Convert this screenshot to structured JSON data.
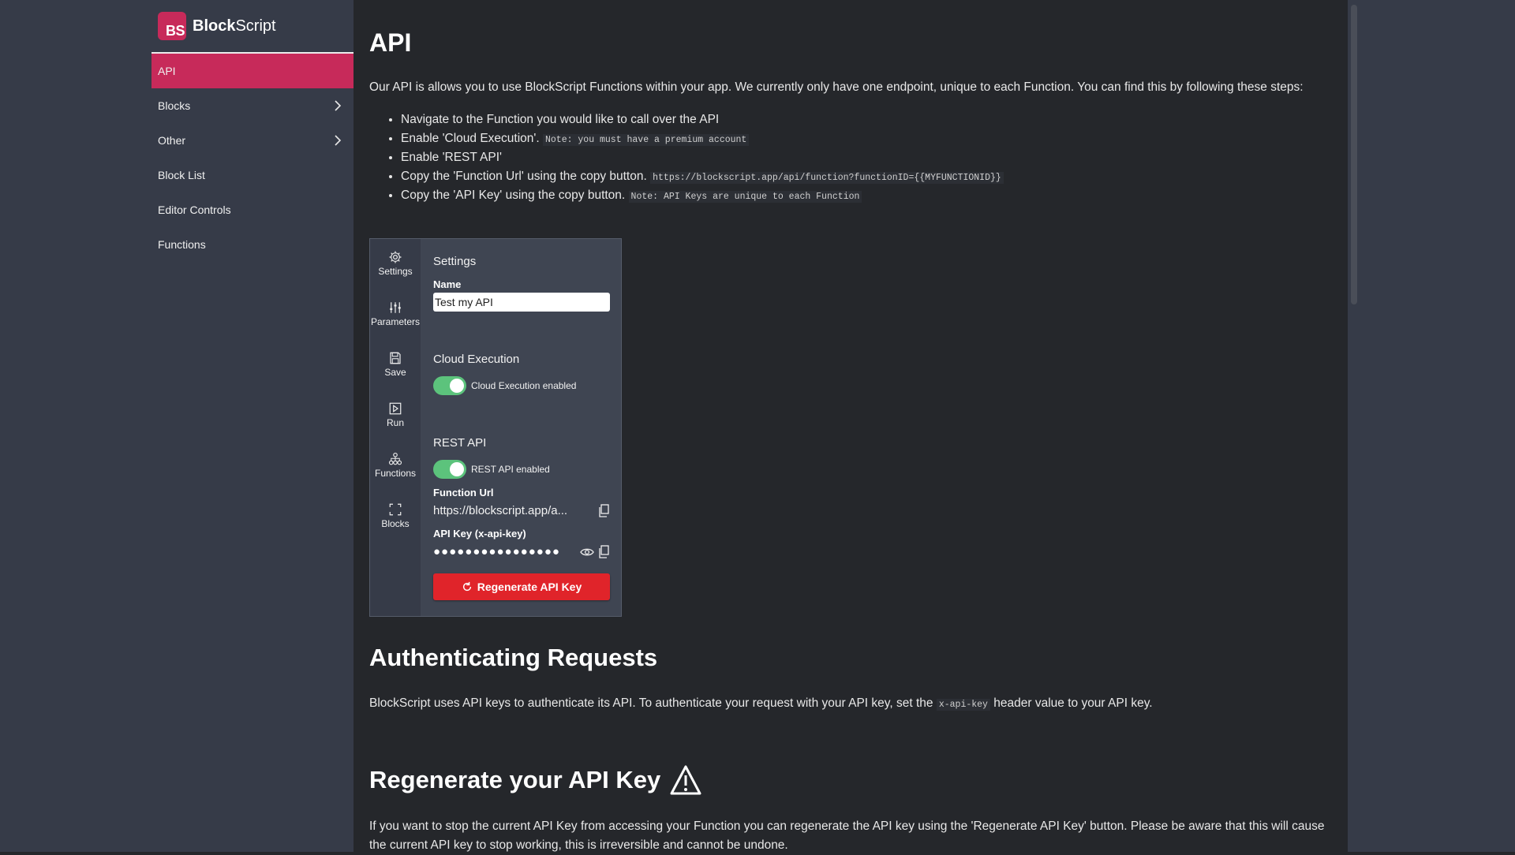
{
  "brand": {
    "logo_text": "BS",
    "name_bold": "Block",
    "name_rest": "Script"
  },
  "nav": [
    {
      "label": "API",
      "active": true,
      "has_chevron": false
    },
    {
      "label": "Blocks",
      "active": false,
      "has_chevron": true
    },
    {
      "label": "Other",
      "active": false,
      "has_chevron": true
    },
    {
      "label": "Block List",
      "active": false,
      "has_chevron": false
    },
    {
      "label": "Editor Controls",
      "active": false,
      "has_chevron": false
    },
    {
      "label": "Functions",
      "active": false,
      "has_chevron": false
    }
  ],
  "page": {
    "title": "API",
    "intro": "Our API is allows you to use BlockScript Functions within your app. We currently only have one endpoint, unique to each Function. You can find this by following these steps:",
    "steps": [
      {
        "text": "Navigate to the Function you would like to call over the API",
        "code": ""
      },
      {
        "text": "Enable 'Cloud Execution'.",
        "code": "Note: you must have a premium account"
      },
      {
        "text": "Enable 'REST API'",
        "code": ""
      },
      {
        "text": "Copy the 'Function Url' using the copy button.",
        "code": "https://blockscript.app/api/function?functionID={{MYFUNCTIONID}}"
      },
      {
        "text": "Copy the 'API Key' using the copy button.",
        "code": "Note: API Keys are unique to each Function"
      }
    ]
  },
  "panel": {
    "side": [
      {
        "label": "Settings",
        "icon": "gear-icon"
      },
      {
        "label": "Parameters",
        "icon": "sliders-icon"
      },
      {
        "label": "Save",
        "icon": "save-icon"
      },
      {
        "label": "Run",
        "icon": "play-icon"
      },
      {
        "label": "Functions",
        "icon": "hierarchy-icon"
      },
      {
        "label": "Blocks",
        "icon": "expand-icon"
      }
    ],
    "title": "Settings",
    "name_label": "Name",
    "name_value": "Test my API",
    "cloud_title": "Cloud Execution",
    "cloud_toggle_label": "Cloud Execution enabled",
    "rest_title": "REST API",
    "rest_toggle_label": "REST API enabled",
    "url_label": "Function Url",
    "url_value": "https://blockscript.app/a...",
    "key_label": "API Key (x-api-key)",
    "key_value": "●●●●●●●●●●●●●●●●",
    "regen_label": "Regenerate API Key"
  },
  "auth": {
    "title": "Authenticating Requests",
    "text_before": "BlockScript uses API keys to authenticate its API. To authenticate your request with your API key, set the ",
    "code": "x-api-key",
    "text_after": " header value to your API key."
  },
  "regen": {
    "title": "Regenerate your API Key",
    "text": "If you want to stop the current API Key from accessing your Function you can regenerate the API key using the 'Regenerate API Key' button. Please be aware that this will cause the current API key to stop working, this is irreversible and cannot be undone."
  },
  "colors": {
    "accent": "#c72a5a",
    "danger": "#e0242a",
    "toggle": "#5cc37c"
  }
}
